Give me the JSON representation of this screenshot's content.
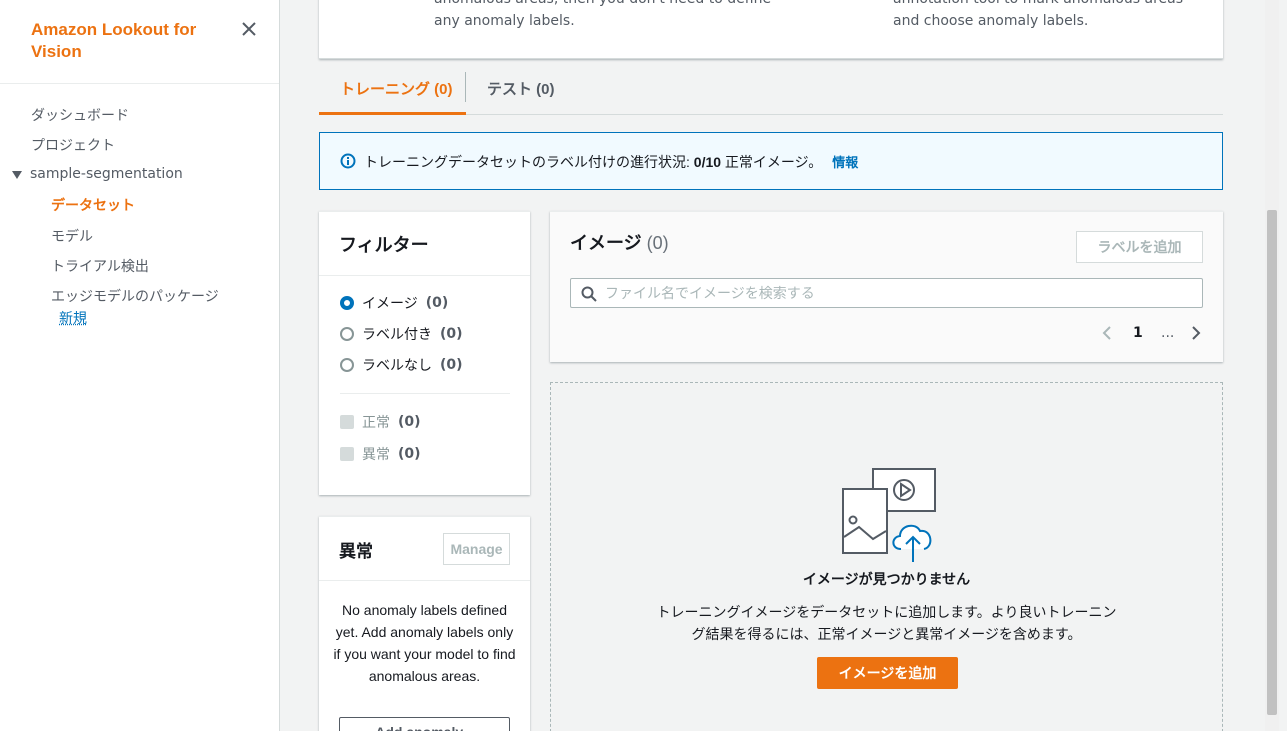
{
  "sidebar": {
    "title": "Amazon Lookout for Vision",
    "nav": {
      "dashboard": "ダッシュボード",
      "projects": "プロジェクト",
      "project_name": "sample-segmentation",
      "dataset": "データセット",
      "models": "モデル",
      "trial_detection": "トライアル検出",
      "edge_package": "エッジモデルのパッケージ",
      "new_badge": "新規"
    }
  },
  "top_card": {
    "left_text": "anomalous areas, then you don't need to define any anomaly labels.",
    "right_text": "annotation tool to mark anomalous areas and choose anomaly labels."
  },
  "tabs": {
    "training": "トレーニング (0)",
    "test": "テスト (0)"
  },
  "info": {
    "prefix": "トレーニングデータセットのラベル付けの進行状況: ",
    "progress": "0/10",
    "suffix": " 正常イメージ。",
    "link": "情報"
  },
  "filter": {
    "title": "フィルター",
    "radios": [
      {
        "label": "イメージ",
        "count": "(0)",
        "selected": true
      },
      {
        "label": "ラベル付き",
        "count": "(0)",
        "selected": false
      },
      {
        "label": "ラベルなし",
        "count": "(0)",
        "selected": false
      }
    ],
    "checks": [
      {
        "label": "正常",
        "count": "(0)"
      },
      {
        "label": "異常",
        "count": "(0)"
      }
    ]
  },
  "anomaly": {
    "title": "異常",
    "manage": "Manage",
    "empty_text": "No anomaly labels defined yet. Add anomaly labels only if you want your model to find anomalous areas.",
    "add_button": "Add anomaly..."
  },
  "images": {
    "title": "イメージ",
    "count": "(0)",
    "add_label": "ラベルを追加",
    "search_placeholder": "ファイル名でイメージを検索する",
    "page": "1",
    "dots": "..."
  },
  "empty_state": {
    "title": "イメージが見つかりません",
    "description": "トレーニングイメージをデータセットに追加します。より良いトレーニング結果を得るには、正常イメージと異常イメージを含めます。",
    "button": "イメージを追加"
  },
  "colors": {
    "accent": "#ec7211",
    "link": "#0073bb",
    "info_bg": "#f1faff"
  }
}
